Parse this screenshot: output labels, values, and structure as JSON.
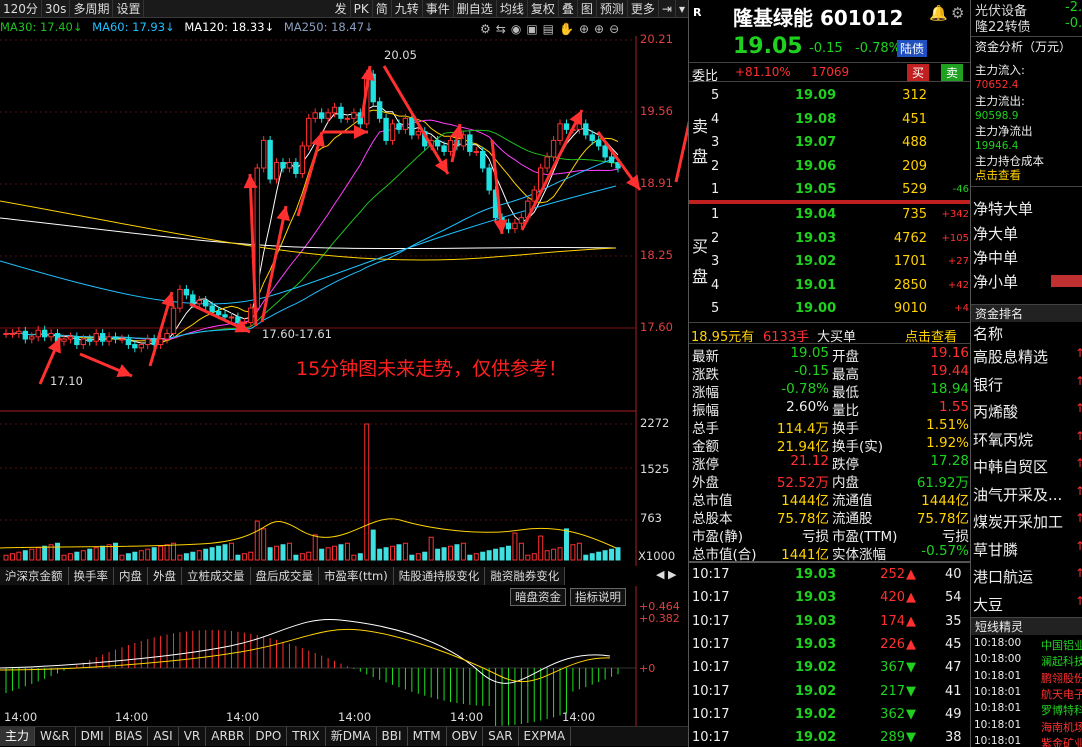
{
  "toolbar": {
    "items": [
      "120分",
      "30s",
      "多周期",
      "设置"
    ],
    "right_items": [
      "发",
      "PK",
      "简",
      "九转",
      "事件",
      "删自选",
      "均线",
      "复权",
      "叠",
      "图",
      "预测",
      "更多"
    ]
  },
  "ma_legend": [
    {
      "label": "MA30: 17.40↓",
      "color": "#20c020"
    },
    {
      "label": "MA60: 17.93↓",
      "color": "#20c0ff"
    },
    {
      "label": "MA120: 18.33↓",
      "color": "#ffffff"
    },
    {
      "label": "MA250: 18.47↓",
      "color": "#8aa0c0"
    }
  ],
  "price_axis": [
    "20.21",
    "19.56",
    "18.91",
    "18.25",
    "17.60"
  ],
  "vol_axis": [
    "2272",
    "1525",
    "763",
    "X1000"
  ],
  "macd_axis": [
    "+0.464",
    "+0.382",
    "+0"
  ],
  "annotations": {
    "high": "20.05",
    "low": "17.10",
    "range": "17.60-17.61",
    "note": "15分钟图未来走势，仅供参考！"
  },
  "indicator_tabs": [
    "沪深京金额",
    "换手率",
    "内盘",
    "外盘",
    "立桩成交量",
    "盘后成交量",
    "市盈率(ttm)",
    "陆股通持股变化",
    "融资融券变化"
  ],
  "macd_buttons": [
    "暗盘资金",
    "指标说明"
  ],
  "time_labels": [
    "14:00",
    "14:00",
    "14:00",
    "14:00",
    "14:00",
    "14:00"
  ],
  "bottom_tabs": [
    "主力",
    "W&R",
    "DMI",
    "BIAS",
    "ASI",
    "VR",
    "ARBR",
    "DPO",
    "TRIX",
    "新DMA",
    "BBI",
    "MTM",
    "OBV",
    "SAR",
    "EXPMA"
  ],
  "stock": {
    "badge": "R",
    "name": "隆基绿能",
    "code": "601012",
    "price": "19.05",
    "change": "-0.15",
    "pct": "-0.78%",
    "tag": "陆债",
    "weibi_label": "委比",
    "weibi_value": "+81.10%",
    "weicha_value": "17069",
    "buy_btn": "买",
    "sell_btn": "卖"
  },
  "sell_side_label": [
    "卖",
    "盘"
  ],
  "buy_side_label": [
    "买",
    "盘"
  ],
  "asks": [
    {
      "n": "5",
      "p": "19.09",
      "v": "312",
      "d": ""
    },
    {
      "n": "4",
      "p": "19.08",
      "v": "451",
      "d": ""
    },
    {
      "n": "3",
      "p": "19.07",
      "v": "488",
      "d": ""
    },
    {
      "n": "2",
      "p": "19.06",
      "v": "209",
      "d": ""
    },
    {
      "n": "1",
      "p": "19.05",
      "v": "529",
      "d": "-46"
    }
  ],
  "bids": [
    {
      "n": "1",
      "p": "19.04",
      "v": "735",
      "d": "+342"
    },
    {
      "n": "2",
      "p": "19.03",
      "v": "4762",
      "d": "+105"
    },
    {
      "n": "3",
      "p": "19.02",
      "v": "1701",
      "d": "+27"
    },
    {
      "n": "4",
      "p": "19.01",
      "v": "2850",
      "d": "+42"
    },
    {
      "n": "5",
      "p": "19.00",
      "v": "9010",
      "d": "+4"
    }
  ],
  "big_order": {
    "price": "18.95元有",
    "qty": "6133手",
    "label": "大买单",
    "link": "点击查看"
  },
  "stats": [
    {
      "l1": "最新",
      "v1": "19.05",
      "c1": "green",
      "l2": "开盘",
      "v2": "19.16",
      "c2": "red"
    },
    {
      "l1": "涨跌",
      "v1": "-0.15",
      "c1": "green",
      "l2": "最高",
      "v2": "19.44",
      "c2": "red"
    },
    {
      "l1": "涨幅",
      "v1": "-0.78%",
      "c1": "green",
      "l2": "最低",
      "v2": "18.94",
      "c2": "green"
    },
    {
      "l1": "振幅",
      "v1": "2.60%",
      "c1": "white",
      "l2": "量比",
      "v2": "1.55",
      "c2": "red"
    },
    {
      "l1": "总手",
      "v1": "114.4万",
      "c1": "yellow",
      "l2": "换手",
      "v2": "1.51%",
      "c2": "yellow"
    },
    {
      "l1": "金额",
      "v1": "21.94亿",
      "c1": "yellow",
      "l2": "换手(实)",
      "v2": "1.92%",
      "c2": "yellow"
    },
    {
      "l1": "涨停",
      "v1": "21.12",
      "c1": "red",
      "l2": "跌停",
      "v2": "17.28",
      "c2": "green"
    },
    {
      "l1": "外盘",
      "v1": "52.52万",
      "c1": "red",
      "l2": "内盘",
      "v2": "61.92万",
      "c2": "green"
    },
    {
      "l1": "总市值",
      "v1": "1444亿",
      "c1": "yellow",
      "l2": "流通值",
      "v2": "1444亿",
      "c2": "yellow"
    },
    {
      "l1": "总股本",
      "v1": "75.78亿",
      "c1": "yellow",
      "l2": "流通股",
      "v2": "75.78亿",
      "c2": "yellow"
    },
    {
      "l1": "市盈(静)",
      "v1": "亏损",
      "c1": "white",
      "l2": "市盈(TTM)",
      "v2": "亏损",
      "c2": "white"
    },
    {
      "l1": "总市值(合)",
      "v1": "1441亿",
      "c1": "yellow",
      "l2": "实体涨幅",
      "v2": "-0.57%",
      "c2": "green"
    }
  ],
  "ticks": [
    {
      "t": "10:17",
      "p": "19.03",
      "v": "252",
      "dir": "up",
      "n": "40"
    },
    {
      "t": "10:17",
      "p": "19.03",
      "v": "420",
      "dir": "up",
      "n": "54"
    },
    {
      "t": "10:17",
      "p": "19.03",
      "v": "174",
      "dir": "up",
      "n": "35"
    },
    {
      "t": "10:17",
      "p": "19.03",
      "v": "226",
      "dir": "up",
      "n": "45"
    },
    {
      "t": "10:17",
      "p": "19.02",
      "v": "367",
      "dir": "down",
      "n": "47"
    },
    {
      "t": "10:17",
      "p": "19.02",
      "v": "217",
      "dir": "down",
      "n": "41"
    },
    {
      "t": "10:17",
      "p": "19.02",
      "v": "362",
      "dir": "down",
      "n": "49"
    },
    {
      "t": "10:17",
      "p": "19.02",
      "v": "289",
      "dir": "down",
      "n": "38"
    }
  ],
  "far_right": {
    "top": [
      {
        "name": "光伏设备",
        "val": "-2."
      },
      {
        "name": "隆22转债",
        "val": "-0."
      }
    ],
    "fund_title": "资金分析（万元）",
    "fund": [
      {
        "label": "主力流入:",
        "val": "70652.4",
        "c": "red"
      },
      {
        "label": "主力流出:",
        "val": "90598.9",
        "c": "green"
      },
      {
        "label": "主力净流出",
        "val": "19946.4",
        "c": "green"
      },
      {
        "label": "主力持仓成本",
        "val": ""
      }
    ],
    "fund_link": "点击查看",
    "net": [
      "净特大单",
      "净大单",
      "净中单",
      "净小单"
    ],
    "rank_title": "资金排名",
    "rank_header": "名称",
    "rank": [
      "高股息精选",
      "银行",
      "丙烯酸",
      "环氧丙烷",
      "中韩自贸区",
      "油气开采及...",
      "煤炭开采加工",
      "草甘膦",
      "港口航运",
      "大豆"
    ],
    "news_title": "短线精灵",
    "news": [
      {
        "t": "10:18:00",
        "s": "中国铝业",
        "c": "green"
      },
      {
        "t": "10:18:00",
        "s": "澜起科技",
        "c": "green"
      },
      {
        "t": "10:18:01",
        "s": "鹏翎股份",
        "c": "red"
      },
      {
        "t": "10:18:01",
        "s": "航天电子",
        "c": "red"
      },
      {
        "t": "10:18:01",
        "s": "罗博特科",
        "c": "green"
      },
      {
        "t": "10:18:01",
        "s": "海南机场",
        "c": "red"
      },
      {
        "t": "10:18:01",
        "s": "紫金矿业",
        "c": "red"
      }
    ]
  }
}
